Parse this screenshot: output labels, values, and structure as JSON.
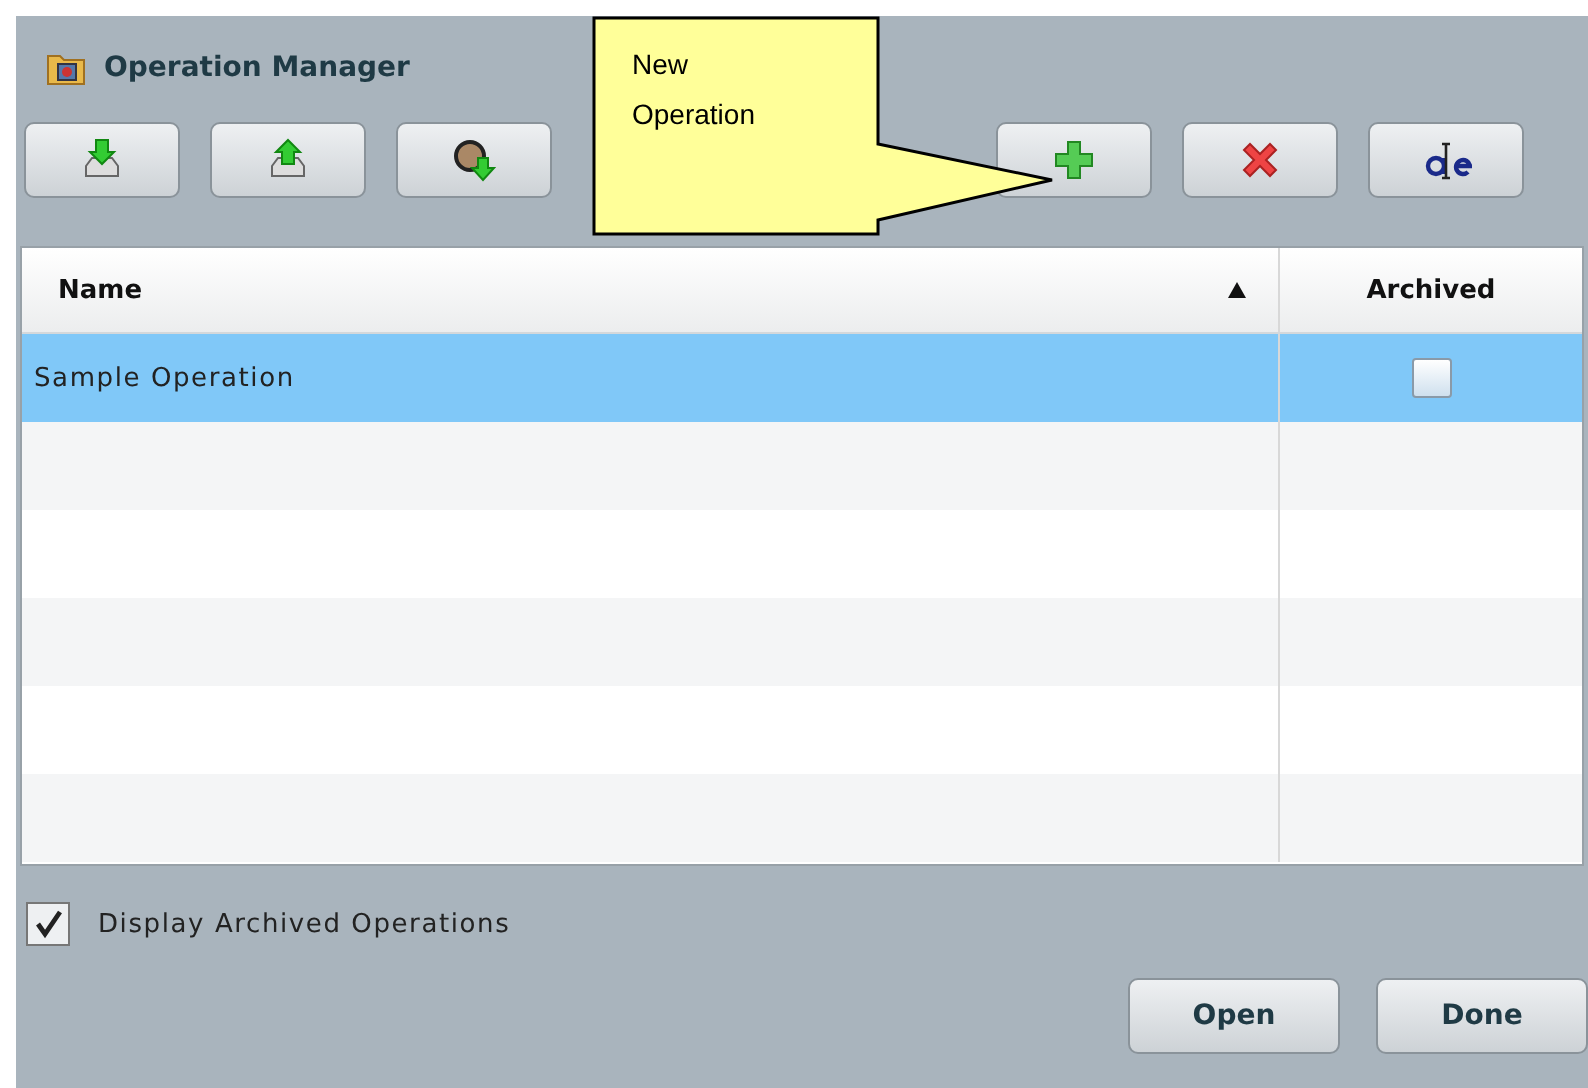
{
  "window": {
    "title": "Operation Manager"
  },
  "toolbar": [
    {
      "kind": "import"
    },
    {
      "kind": "export"
    },
    {
      "kind": "sync"
    },
    {
      "kind": "add"
    },
    {
      "kind": "delete"
    },
    {
      "kind": "rename"
    }
  ],
  "callout": {
    "text": "New Operation"
  },
  "table": {
    "columns": [
      {
        "label": "Name",
        "sorted": true
      },
      {
        "label": "Archived"
      }
    ],
    "rows": [
      {
        "name": "Sample Operation",
        "archived": false,
        "selected": true
      }
    ]
  },
  "display_archived": {
    "label": "Display Archived Operations",
    "checked": true
  },
  "buttons": [
    "Open",
    "Done"
  ]
}
